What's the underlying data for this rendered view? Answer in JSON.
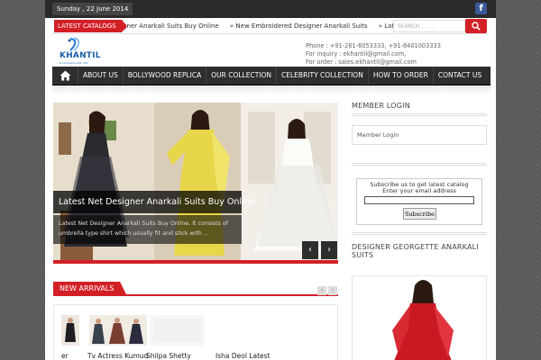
{
  "topbar": {
    "date": "Sunday , 22 June 2014",
    "social_icon": "facebook-icon",
    "social_letter": "f"
  },
  "ticker": {
    "label": "LATEST CATALOGS",
    "items": [
      "gner Anarkali Suits Buy Online",
      "» New Embroidered Designer Anarkali Suits",
      "» Latest Designer P"
    ],
    "search_placeholder": "SEARCH . . . ."
  },
  "header": {
    "logo_text": "KHANTIL",
    "logo_tagline": "E-commerce Pvt. Ltd",
    "phone": "Phone : +91-261-6053333, +91-8401003333",
    "inquiry": "For inquiry : ekhantil@gmail.com,",
    "order": "For order : sales.ekhantil@gmail.com"
  },
  "nav": {
    "home_icon": "home-icon",
    "items": [
      "ABOUT US",
      "BOLLYWOOD REPLICA",
      "OUR COLLECTION",
      "CELEBRITY COLLECTION",
      "HOW TO ORDER",
      "CONTACT US"
    ]
  },
  "slider": {
    "title": "Latest Net Designer Anarkali Suits Buy Online",
    "description": "Latest Net Designer Anarkali Suits Buy Online, It consists of umbrella type shirt which usually fit and stick with ...",
    "prev": "‹",
    "next": "›"
  },
  "new_arrivals": {
    "label": "NEW ARRIVALS",
    "prev": "‹",
    "next": "›",
    "items": [
      {
        "title": "er"
      },
      {
        "title": "Tv Actress Kumud"
      },
      {
        "title": "Shilpa Shetty"
      },
      {
        "title": "Isha Deol Latest"
      }
    ]
  },
  "sidebar": {
    "member_login_title": "MEMBER LOGIN",
    "member_login_link": "Member Login",
    "subscribe_text": "Subscribe us to get latest catalog",
    "email_label": "Enter your email address",
    "subscribe_button": "Subscribe",
    "georgette_title": "DESIGNER GEORGETTE ANARKALI SUITS"
  },
  "colors": {
    "accent": "#d32027",
    "nav_bg": "#2e2e2e",
    "topbar_bg": "#2a2a2a",
    "logo_blue": "#1b5ea8"
  }
}
